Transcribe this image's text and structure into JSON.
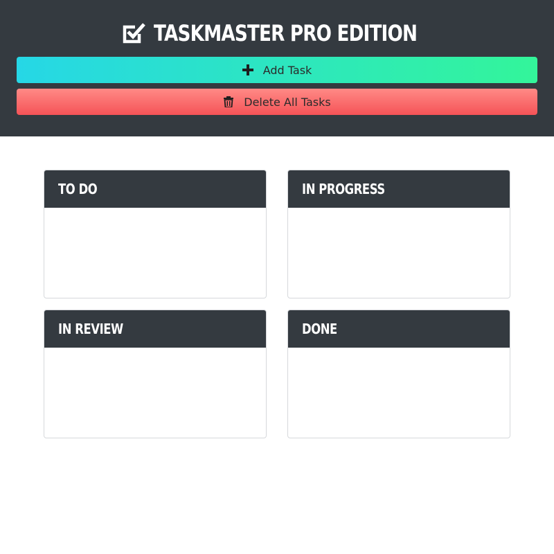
{
  "header": {
    "title": "TASKMASTER PRO EDITION",
    "title_icon": "checkbox-checked-icon"
  },
  "actions": {
    "add_label": "Add Task",
    "add_icon": "plus-icon",
    "delete_label": "Delete All Tasks",
    "delete_icon": "trash-icon"
  },
  "columns": [
    {
      "title": "TO DO",
      "tasks": []
    },
    {
      "title": "IN PROGRESS",
      "tasks": []
    },
    {
      "title": "IN REVIEW",
      "tasks": []
    },
    {
      "title": "DONE",
      "tasks": []
    }
  ],
  "colors": {
    "header_bg": "#343a40",
    "add_gradient_start": "#26d7e6",
    "add_gradient_end": "#33f59a",
    "delete_gradient_start": "#ff8a86",
    "delete_gradient_end": "#f55357"
  }
}
